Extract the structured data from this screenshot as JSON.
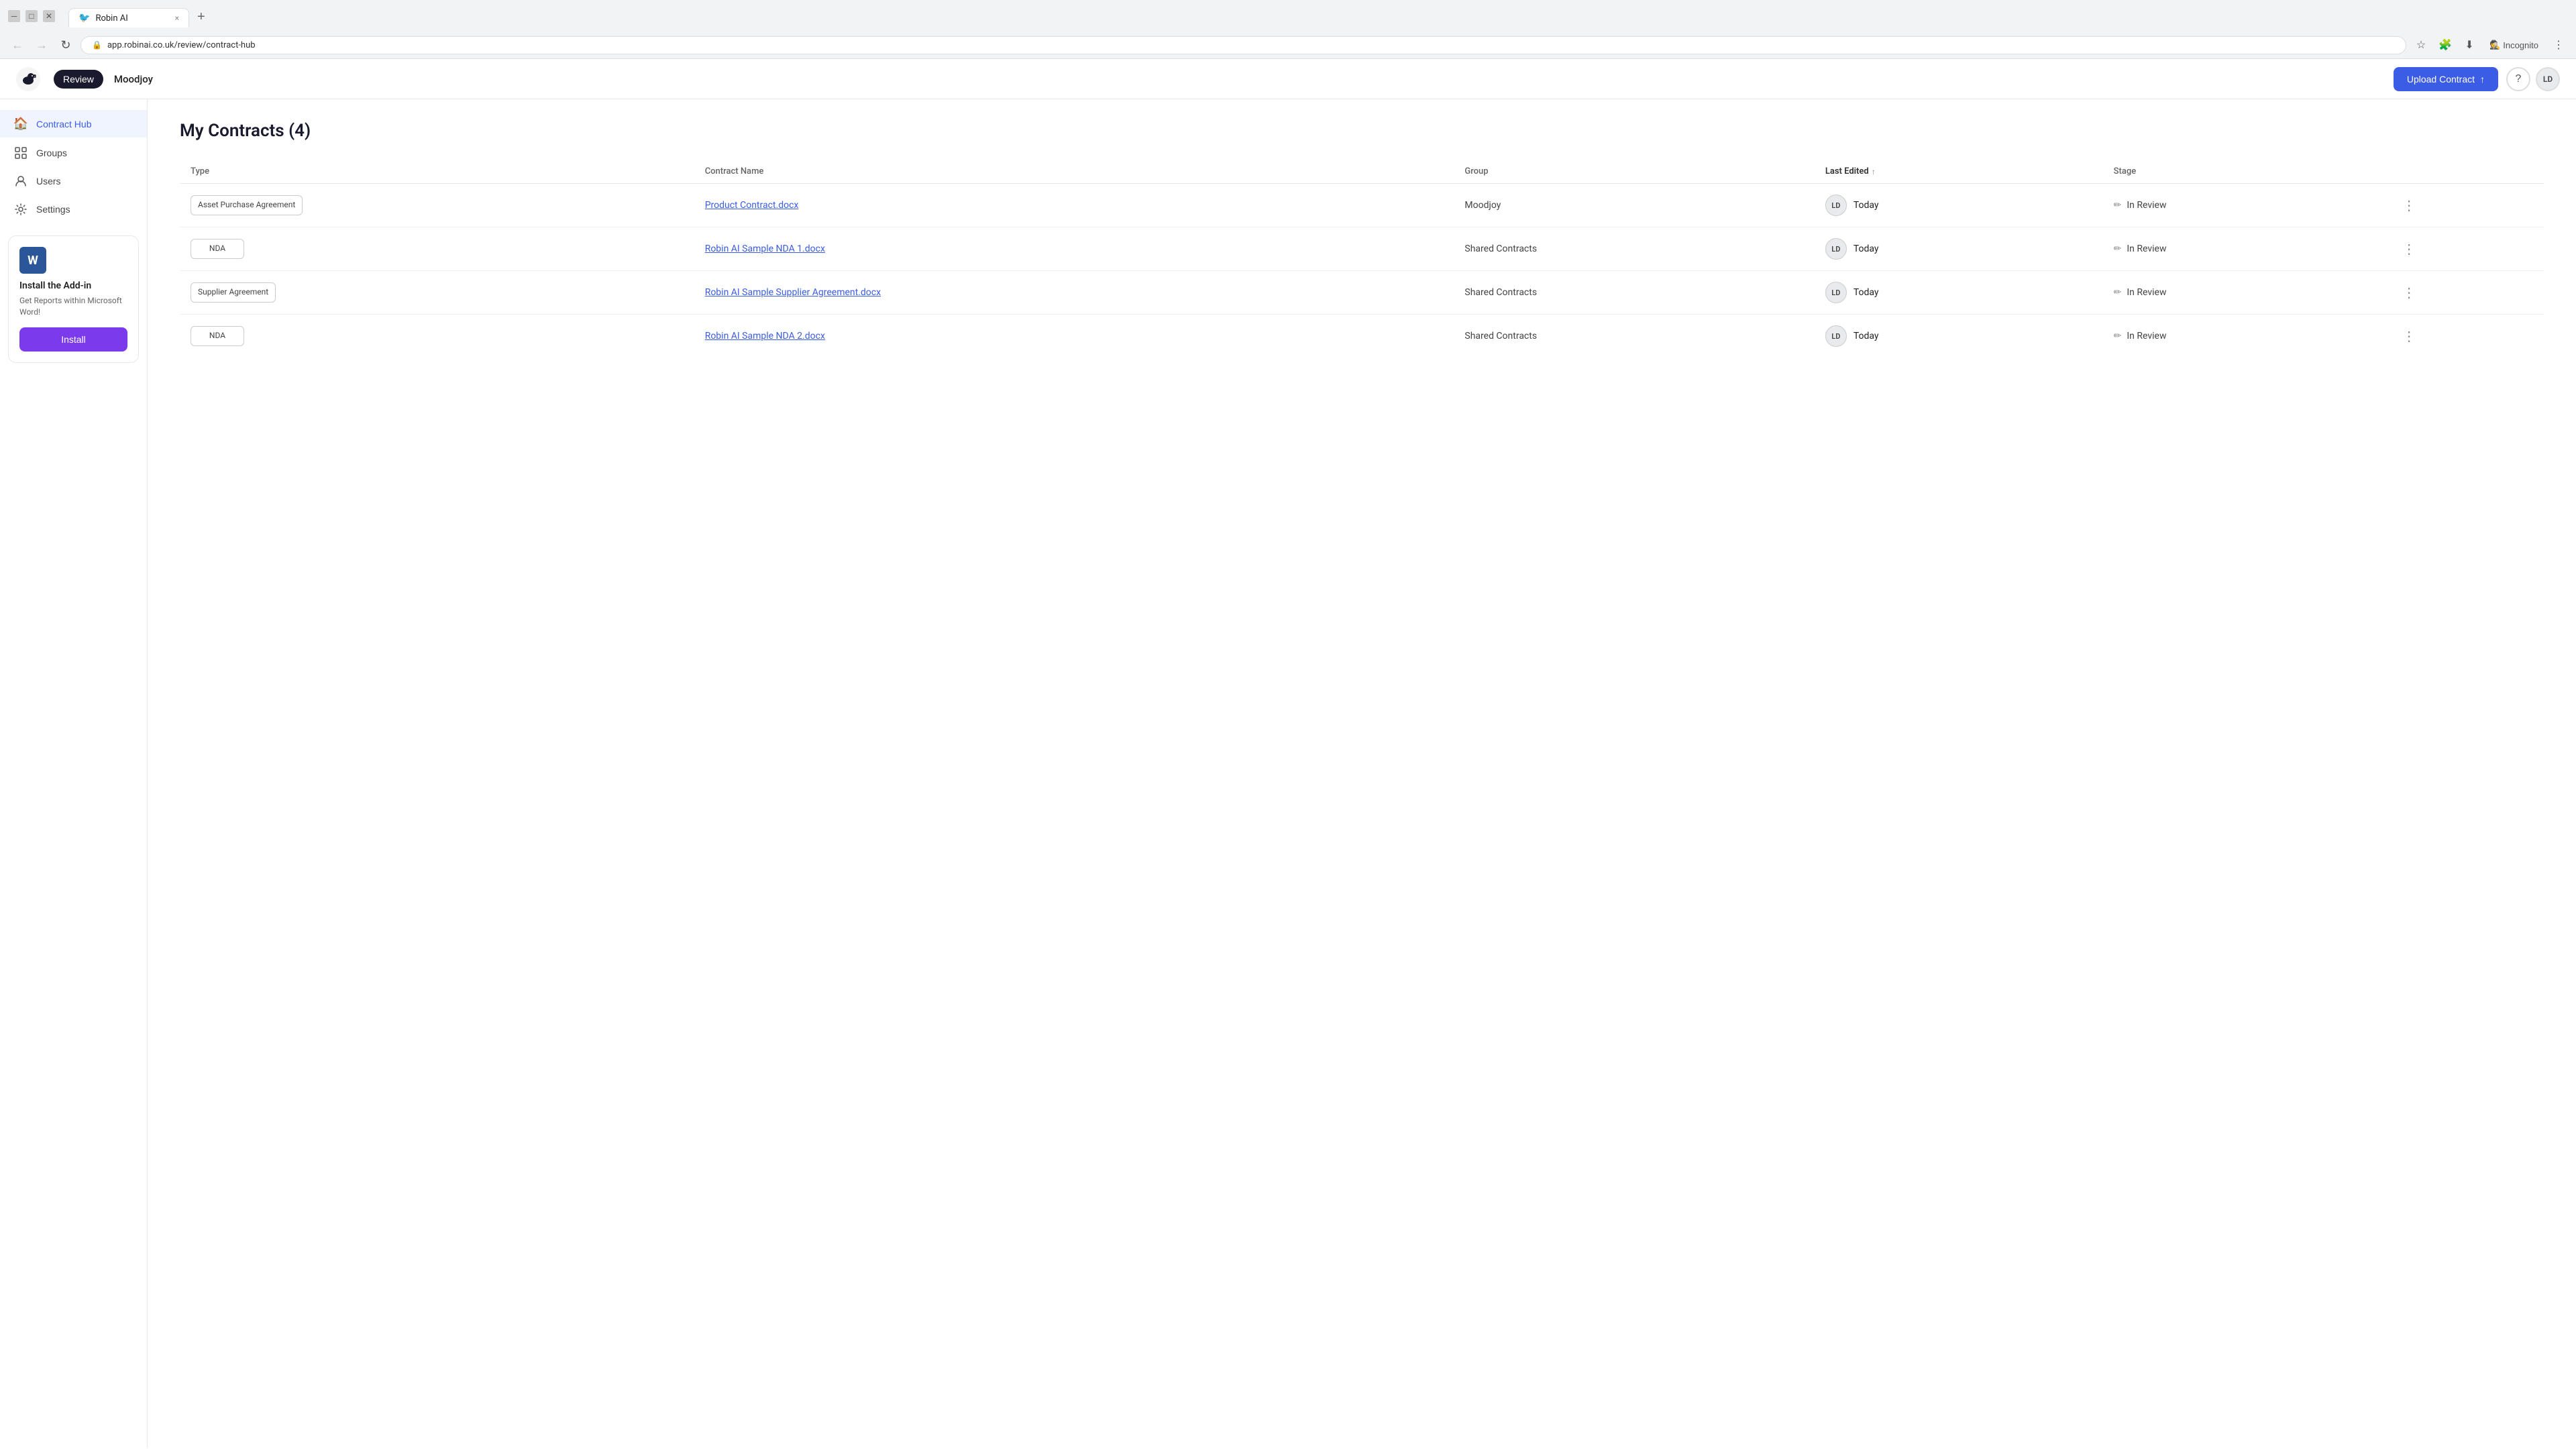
{
  "browser": {
    "tab_label": "Robin AI",
    "tab_close": "×",
    "new_tab": "+",
    "address": "app.robinai.co.uk/review/contract-hub",
    "incognito_label": "Incognito",
    "nav_back": "←",
    "nav_forward": "→",
    "nav_refresh": "↻"
  },
  "header": {
    "nav_review": "Review",
    "workspace": "Moodjoy",
    "upload_label": "Upload Contract",
    "help_icon": "?",
    "avatar_initials": "LD"
  },
  "sidebar": {
    "items": [
      {
        "id": "contract-hub",
        "label": "Contract Hub",
        "icon": "🏠",
        "active": true
      },
      {
        "id": "groups",
        "label": "Groups",
        "icon": "⊞",
        "active": false
      },
      {
        "id": "users",
        "label": "Users",
        "icon": "👤",
        "active": false
      },
      {
        "id": "settings",
        "label": "Settings",
        "icon": "⚙️",
        "active": false
      }
    ],
    "addon": {
      "word_icon": "W",
      "title": "Install the Add-in",
      "description": "Get Reports within Microsoft Word!",
      "install_label": "Install"
    }
  },
  "main": {
    "page_title": "My Contracts (4)",
    "columns": {
      "type": "Type",
      "contract_name": "Contract Name",
      "group": "Group",
      "last_edited": "Last Edited",
      "stage": "Stage"
    },
    "rows": [
      {
        "type": "Asset Purchase Agreement",
        "contract_name": "Product Contract.docx",
        "group": "Moodjoy",
        "last_edited_avatar": "LD",
        "last_edited_time": "Today",
        "stage": "In Review"
      },
      {
        "type": "NDA",
        "contract_name": "Robin AI Sample NDA 1.docx",
        "group": "Shared Contracts",
        "last_edited_avatar": "LD",
        "last_edited_time": "Today",
        "stage": "In Review"
      },
      {
        "type": "Supplier Agreement",
        "contract_name": "Robin AI Sample Supplier Agreement.docx",
        "group": "Shared Contracts",
        "last_edited_avatar": "LD",
        "last_edited_time": "Today",
        "stage": "In Review"
      },
      {
        "type": "NDA",
        "contract_name": "Robin AI Sample NDA 2.docx",
        "group": "Shared Contracts",
        "last_edited_avatar": "LD",
        "last_edited_time": "Today",
        "stage": "In Review"
      }
    ]
  }
}
